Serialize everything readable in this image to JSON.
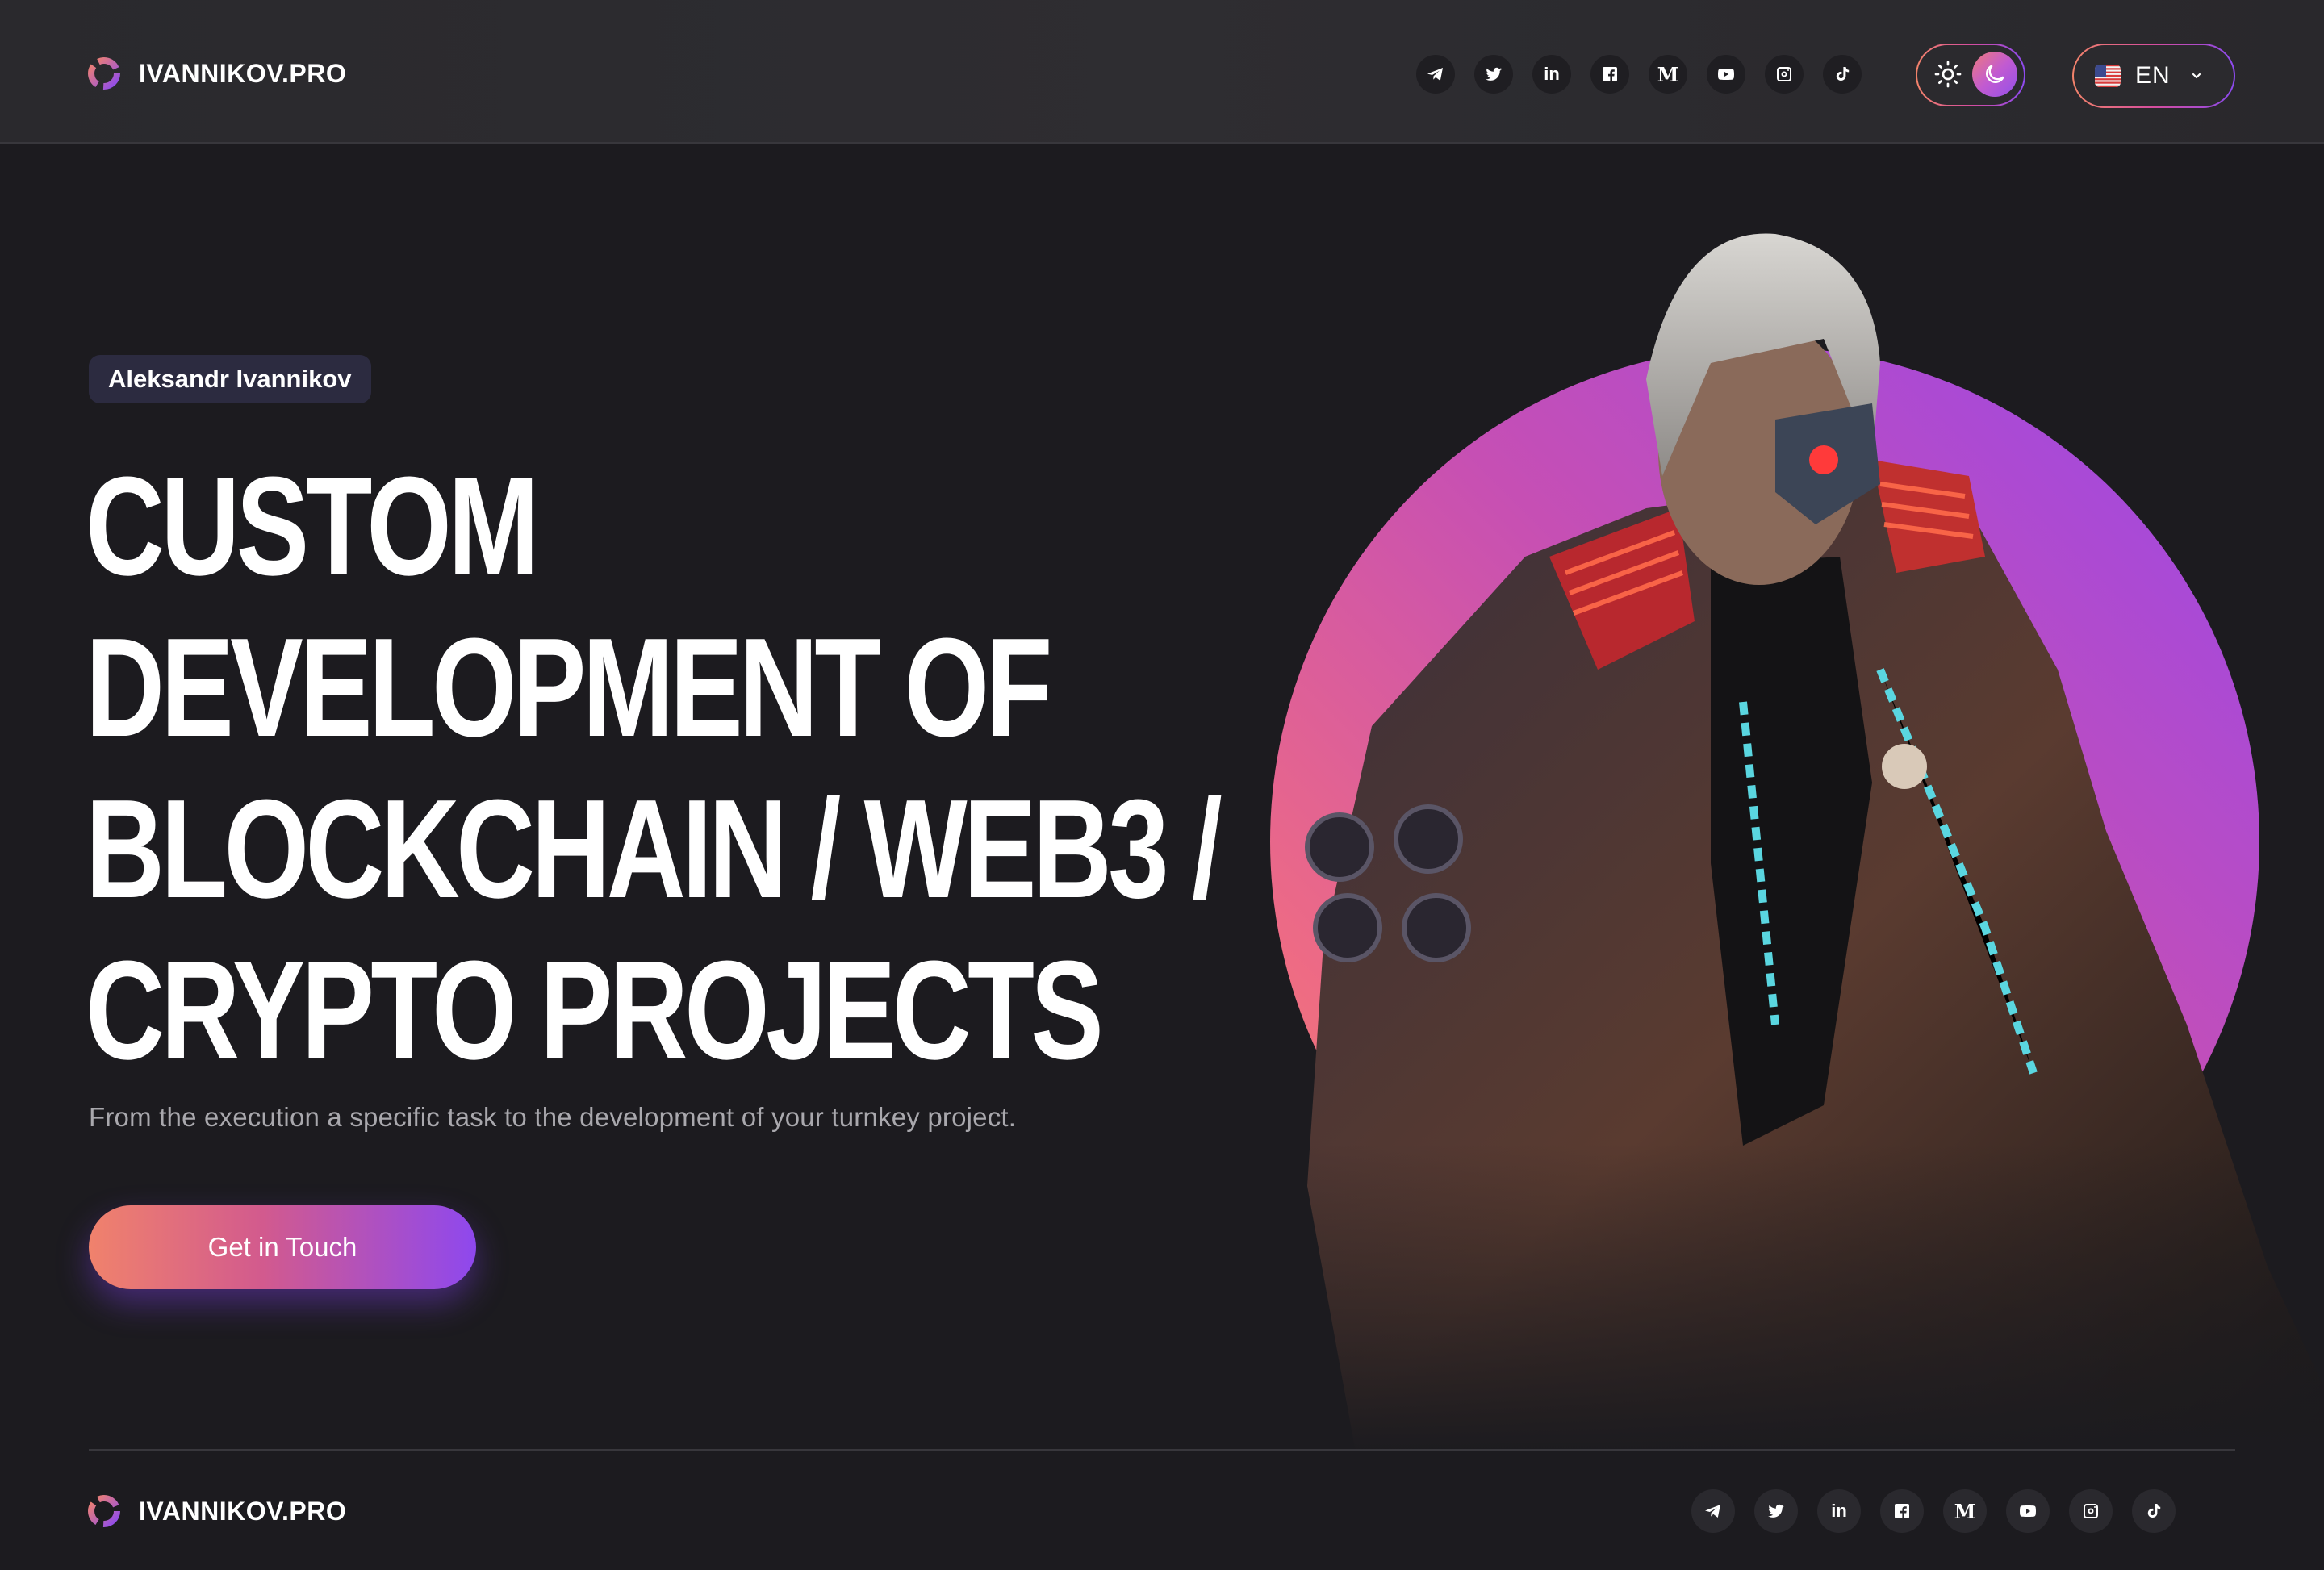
{
  "header": {
    "brand": "IVANNIKOV.PRO",
    "socials": [
      {
        "name": "telegram-icon"
      },
      {
        "name": "twitter-icon"
      },
      {
        "name": "linkedin-icon",
        "glyph": "in"
      },
      {
        "name": "facebook-icon"
      },
      {
        "name": "medium-icon",
        "glyph": "M"
      },
      {
        "name": "youtube-icon"
      },
      {
        "name": "instagram-icon"
      },
      {
        "name": "tiktok-icon"
      }
    ],
    "theme_toggle": {
      "icons": [
        "sun-icon",
        "moon-icon"
      ],
      "selected": "dark"
    },
    "language": {
      "code": "EN",
      "flag": "us-flag-icon"
    }
  },
  "hero": {
    "name_badge": "Aleksandr Ivannikov",
    "headline_lines": [
      "CUSTOM",
      "DEVELOPMENT OF",
      "BLOCKCHAIN / WEB3 /",
      "CRYPTO PROJECTS"
    ],
    "subtitle": "From the execution a specific task to the development of your turnkey project.",
    "cta_label": "Get in Touch"
  },
  "footer": {
    "brand": "IVANNIKOV.PRO"
  },
  "colors": {
    "background": "#1c1b1f",
    "accent_start": "#f0826c",
    "accent_end": "#8e48ee"
  }
}
